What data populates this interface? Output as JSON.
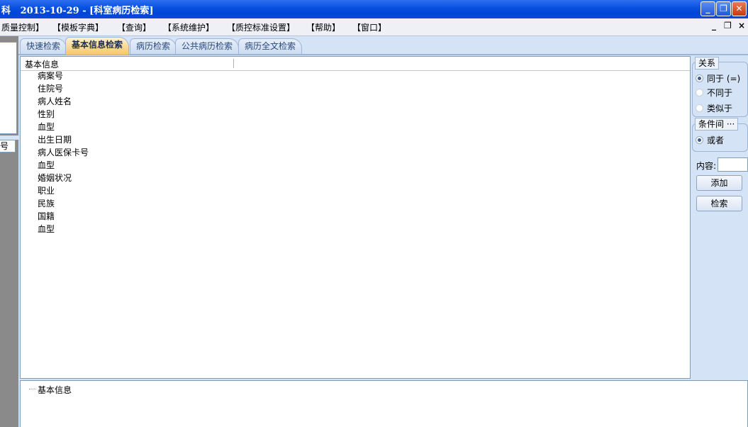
{
  "window": {
    "title": "科   2013-10-29 - [科室病历检索]",
    "controls": {
      "minimize": "_",
      "restore": "❐",
      "close": "✕"
    }
  },
  "menu": {
    "items": [
      "质量控制】",
      "【模板字典】",
      "【查询】",
      "【系统维护】",
      "【质控标准设置】",
      "【帮助】",
      "【窗口】"
    ],
    "mdi_controls": [
      "_",
      "❐",
      "×"
    ]
  },
  "left_panel": {
    "header": "号"
  },
  "tabs": [
    {
      "label": "快速检索",
      "active": false
    },
    {
      "label": "基本信息检索",
      "active": true
    },
    {
      "label": "病历检索",
      "active": false
    },
    {
      "label": "公共病历检索",
      "active": false
    },
    {
      "label": "病历全文检索",
      "active": false
    }
  ],
  "list": {
    "header": "基本信息",
    "items": [
      "病案号",
      "住院号",
      "病人姓名",
      "性别",
      "血型",
      "出生日期",
      "病人医保卡号",
      "血型",
      "婚姻状况",
      "职业",
      "民族",
      "国籍",
      "血型"
    ]
  },
  "relation": {
    "label": "关系",
    "options": [
      {
        "label": "同于 (=)",
        "checked": true,
        "enabled": true
      },
      {
        "label": "不同于",
        "checked": false,
        "enabled": false
      },
      {
        "label": "类似于",
        "checked": false,
        "enabled": false
      }
    ]
  },
  "condition": {
    "label": "条件间 ···",
    "options": [
      {
        "label": "或者",
        "checked": true,
        "enabled": true
      }
    ]
  },
  "content": {
    "label": "内容:",
    "value": ""
  },
  "buttons": {
    "add": "添加",
    "search": "检索"
  },
  "tree": {
    "root": "基本信息"
  }
}
